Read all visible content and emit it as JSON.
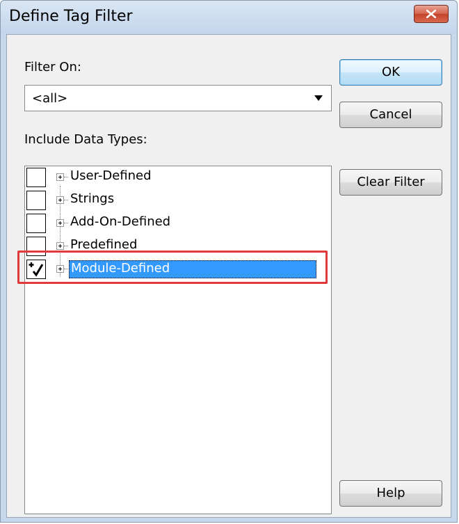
{
  "dialog": {
    "title": "Define Tag Filter",
    "close_icon": "close-x-icon"
  },
  "filter_on": {
    "label": "Filter On:",
    "selected": "<all>"
  },
  "include_data_types": {
    "label": "Include Data Types:",
    "items": [
      {
        "label": "User-Defined",
        "checked": false,
        "selected": false
      },
      {
        "label": "Strings",
        "checked": false,
        "selected": false
      },
      {
        "label": "Add-On-Defined",
        "checked": false,
        "selected": false
      },
      {
        "label": "Predefined",
        "checked": false,
        "selected": false
      },
      {
        "label": "Module-Defined",
        "checked": true,
        "selected": true
      }
    ]
  },
  "buttons": {
    "ok": "OK",
    "cancel": "Cancel",
    "clear_filter": "Clear Filter",
    "help": "Help"
  },
  "colors": {
    "selection": "#3399ff",
    "highlight_box": "#e03a3a",
    "close_button": "#c2422a"
  }
}
